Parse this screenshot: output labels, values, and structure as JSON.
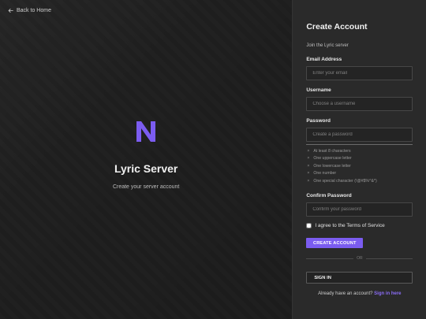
{
  "left": {
    "back_label": "Back to Home",
    "logo_letter": "N",
    "title": "Lyric Server",
    "subtitle": "Create your server account"
  },
  "form": {
    "title": "Create Account",
    "subtitle": "Join the Lyric server",
    "email_label": "Email Address",
    "email_placeholder": "Enter your email",
    "username_label": "Username",
    "username_placeholder": "Choose a username",
    "password_label": "Password",
    "password_placeholder": "Create a password",
    "requirements": [
      {
        "icon": "×",
        "text": "At least 8 characters"
      },
      {
        "icon": "×",
        "text": "One uppercase letter"
      },
      {
        "icon": "×",
        "text": "One lowercase letter"
      },
      {
        "icon": "×",
        "text": "One number"
      },
      {
        "icon": "×",
        "text": "One special character (!@#$%^&*)"
      }
    ],
    "confirm_label": "Confirm Password",
    "confirm_placeholder": "Confirm your password",
    "terms_label": "I agree to the Terms of Service",
    "terms_checked": false,
    "create_button": "CREATE ACCOUNT",
    "divider_text": "OR",
    "signin_button": "SIGN IN",
    "footer_text": "Already have an account?",
    "footer_link": "Sign in here"
  },
  "colors": {
    "accent": "#7b5cf0",
    "left_bg": "#1e1e1e",
    "right_bg": "#2a2a2a"
  }
}
